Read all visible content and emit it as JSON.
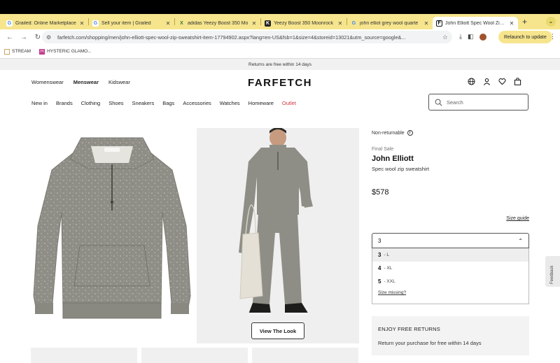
{
  "browser": {
    "tabs": [
      {
        "title": "Grailed: Online Marketplace",
        "icon": "G"
      },
      {
        "title": "Sell your item | Grailed",
        "icon": "G"
      },
      {
        "title": "adidas Yeezy Boost 350 Mo",
        "icon": "X"
      },
      {
        "title": "Yeezy Boost 350 Moonrock",
        "icon": "K"
      },
      {
        "title": "john elliot grey wool quarte",
        "icon": "G"
      },
      {
        "title": "John Elliott Spec Wool Zip S",
        "icon": "F"
      }
    ],
    "new_tab": "+",
    "tab_menu": "⌄",
    "url": "farfetch.com/shopping/men/john-elliott-spec-wool-zip-sweatshirt-item-17794902.aspx?lang=en-US&fsb=1&size=4&storeid=13021&utm_source=google&...",
    "relaunch_label": "Relaunch to update",
    "bookmarks": [
      "STREAM",
      "HYSTERIC GLAMO..."
    ]
  },
  "site": {
    "banner": "Returns are free within 14 days",
    "logo": "FARFETCH",
    "departments": [
      "Womenswear",
      "Menswear",
      "Kidswear"
    ],
    "categories": [
      "New in",
      "Brands",
      "Clothing",
      "Shoes",
      "Sneakers",
      "Bags",
      "Accessories",
      "Watches",
      "Homeware",
      "Outlet"
    ],
    "search_placeholder": "Search"
  },
  "product": {
    "non_returnable": "Non-returnable",
    "final_sale": "Final Sale",
    "brand": "John Elliott",
    "description": "Spec wool zip sweatshirt",
    "price": "$578",
    "size_guide": "Size guide",
    "selected_size": "3",
    "size_options": [
      {
        "size": "3",
        "label": "- L"
      },
      {
        "size": "4",
        "label": "- XL"
      },
      {
        "size": "5",
        "label": "- XXL"
      }
    ],
    "size_missing": "Size missing?",
    "view_look": "View The Look",
    "returns_title": "ENJOY FREE RETURNS",
    "returns_text": "Return your purchase for free within 14 days"
  },
  "feedback": "Feedback",
  "colors": {
    "accent": "#f6e58d",
    "outlet": "#d4313c",
    "sweatshirt": "#8d8c84"
  }
}
